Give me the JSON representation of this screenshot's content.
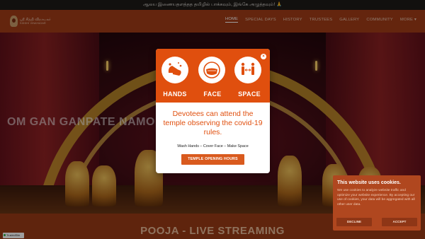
{
  "ticker": {
    "text": "ஆலய இணையதளத்தத தமிழில் பாக்கவும், இங்கே அழுத்தவும்! 🙏"
  },
  "logo": {
    "line1": "ஸ்ரீ சித்தி விநாயகர்",
    "line2": "SIDDHI VINAYAGAR"
  },
  "nav": {
    "items": [
      "HOME",
      "SPECIAL DAYS",
      "HISTORY",
      "TRUSTEES",
      "GALLERY",
      "COMMUNITY",
      "MORE ▾"
    ],
    "active": "HOME"
  },
  "hero": {
    "text": "OM GAN GANPATE NAMO NAM"
  },
  "section_title": "POOJA - LIVE STREAMING",
  "trusted_badge": "TrustedSite",
  "modal": {
    "icons": [
      {
        "label": "HANDS",
        "icon": "hand-wash-icon"
      },
      {
        "label": "FACE",
        "icon": "face-mask-icon"
      },
      {
        "label": "SPACE",
        "icon": "social-distance-icon"
      }
    ],
    "heading": "Devotees can attend the temple observing the covid-19 rules.",
    "sub": "Wash Hands – Cover Face – Make Space",
    "button": "TEMPLE OPENING HOURS",
    "close": "×"
  },
  "cookie": {
    "title": "This website uses cookies.",
    "text": "We use cookies to analyze website traffic and optimize your website experience. By accepting our use of cookies, your data will be aggregated with all other user data.",
    "decline": "DECLINE",
    "accept": "ACCEPT"
  },
  "colors": {
    "brand": "#a23d18",
    "accent": "#e04f0e",
    "modal_bg": "#ffffff"
  }
}
